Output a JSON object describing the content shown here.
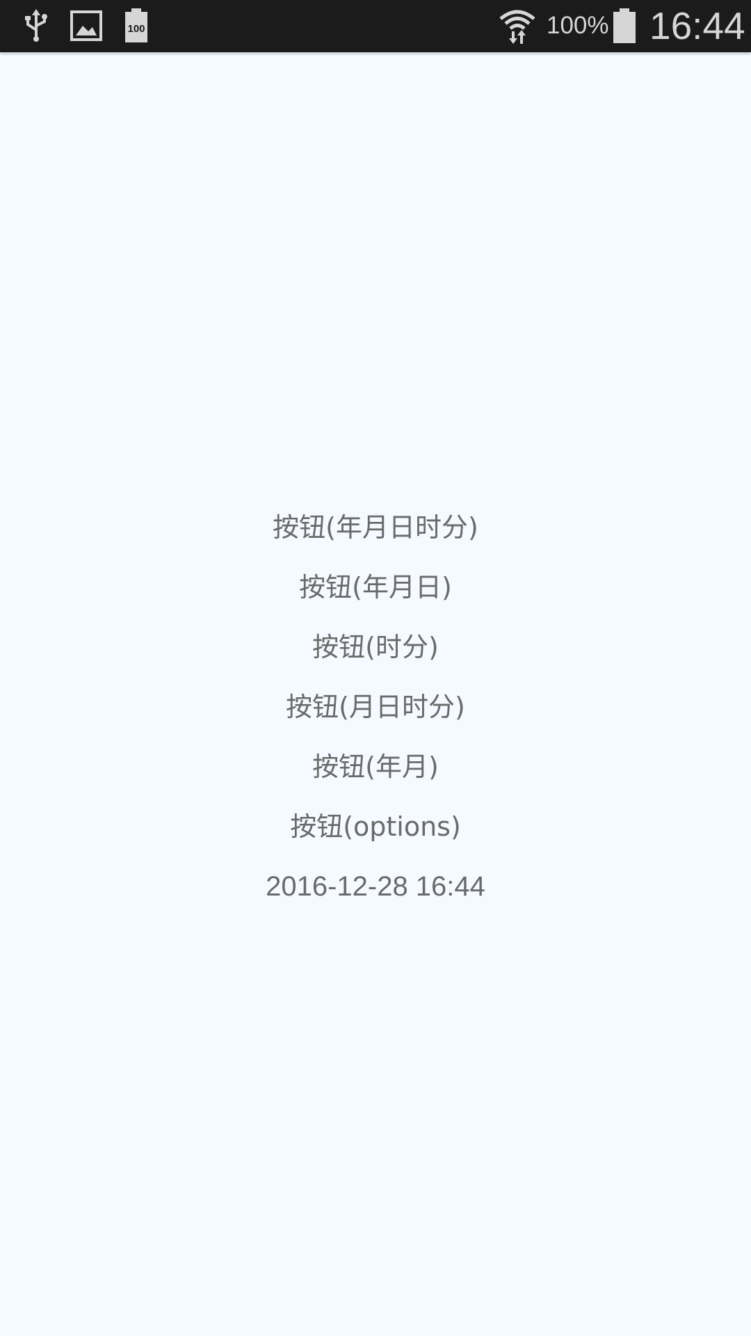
{
  "status_bar": {
    "battery_percent": "100%",
    "time": "16:44",
    "battery_icon_label": "100",
    "icons": [
      "usb-icon",
      "image-icon",
      "battery-saver-icon",
      "wifi-icon",
      "battery-icon"
    ]
  },
  "main": {
    "buttons": [
      {
        "label": "按钮(年月日时分)"
      },
      {
        "label": "按钮(年月日)"
      },
      {
        "label": "按钮(时分)"
      },
      {
        "label": "按钮(月日时分)"
      },
      {
        "label": "按钮(年月)"
      },
      {
        "label": "按钮(options)"
      }
    ],
    "result": "2016-12-28 16:44"
  }
}
